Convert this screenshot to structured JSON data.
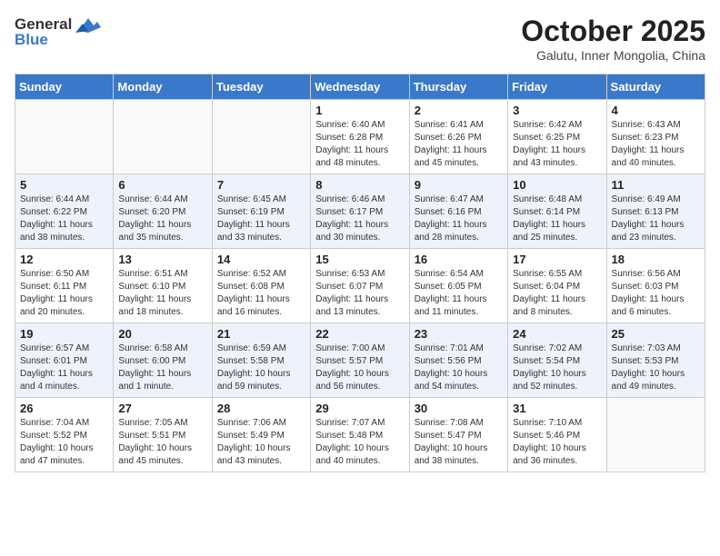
{
  "logo": {
    "general": "General",
    "blue": "Blue"
  },
  "title": "October 2025",
  "subtitle": "Galutu, Inner Mongolia, China",
  "days_of_week": [
    "Sunday",
    "Monday",
    "Tuesday",
    "Wednesday",
    "Thursday",
    "Friday",
    "Saturday"
  ],
  "weeks": [
    [
      {
        "day": "",
        "info": ""
      },
      {
        "day": "",
        "info": ""
      },
      {
        "day": "",
        "info": ""
      },
      {
        "day": "1",
        "info": "Sunrise: 6:40 AM\nSunset: 6:28 PM\nDaylight: 11 hours\nand 48 minutes."
      },
      {
        "day": "2",
        "info": "Sunrise: 6:41 AM\nSunset: 6:26 PM\nDaylight: 11 hours\nand 45 minutes."
      },
      {
        "day": "3",
        "info": "Sunrise: 6:42 AM\nSunset: 6:25 PM\nDaylight: 11 hours\nand 43 minutes."
      },
      {
        "day": "4",
        "info": "Sunrise: 6:43 AM\nSunset: 6:23 PM\nDaylight: 11 hours\nand 40 minutes."
      }
    ],
    [
      {
        "day": "5",
        "info": "Sunrise: 6:44 AM\nSunset: 6:22 PM\nDaylight: 11 hours\nand 38 minutes."
      },
      {
        "day": "6",
        "info": "Sunrise: 6:44 AM\nSunset: 6:20 PM\nDaylight: 11 hours\nand 35 minutes."
      },
      {
        "day": "7",
        "info": "Sunrise: 6:45 AM\nSunset: 6:19 PM\nDaylight: 11 hours\nand 33 minutes."
      },
      {
        "day": "8",
        "info": "Sunrise: 6:46 AM\nSunset: 6:17 PM\nDaylight: 11 hours\nand 30 minutes."
      },
      {
        "day": "9",
        "info": "Sunrise: 6:47 AM\nSunset: 6:16 PM\nDaylight: 11 hours\nand 28 minutes."
      },
      {
        "day": "10",
        "info": "Sunrise: 6:48 AM\nSunset: 6:14 PM\nDaylight: 11 hours\nand 25 minutes."
      },
      {
        "day": "11",
        "info": "Sunrise: 6:49 AM\nSunset: 6:13 PM\nDaylight: 11 hours\nand 23 minutes."
      }
    ],
    [
      {
        "day": "12",
        "info": "Sunrise: 6:50 AM\nSunset: 6:11 PM\nDaylight: 11 hours\nand 20 minutes."
      },
      {
        "day": "13",
        "info": "Sunrise: 6:51 AM\nSunset: 6:10 PM\nDaylight: 11 hours\nand 18 minutes."
      },
      {
        "day": "14",
        "info": "Sunrise: 6:52 AM\nSunset: 6:08 PM\nDaylight: 11 hours\nand 16 minutes."
      },
      {
        "day": "15",
        "info": "Sunrise: 6:53 AM\nSunset: 6:07 PM\nDaylight: 11 hours\nand 13 minutes."
      },
      {
        "day": "16",
        "info": "Sunrise: 6:54 AM\nSunset: 6:05 PM\nDaylight: 11 hours\nand 11 minutes."
      },
      {
        "day": "17",
        "info": "Sunrise: 6:55 AM\nSunset: 6:04 PM\nDaylight: 11 hours\nand 8 minutes."
      },
      {
        "day": "18",
        "info": "Sunrise: 6:56 AM\nSunset: 6:03 PM\nDaylight: 11 hours\nand 6 minutes."
      }
    ],
    [
      {
        "day": "19",
        "info": "Sunrise: 6:57 AM\nSunset: 6:01 PM\nDaylight: 11 hours\nand 4 minutes."
      },
      {
        "day": "20",
        "info": "Sunrise: 6:58 AM\nSunset: 6:00 PM\nDaylight: 11 hours\nand 1 minute."
      },
      {
        "day": "21",
        "info": "Sunrise: 6:59 AM\nSunset: 5:58 PM\nDaylight: 10 hours\nand 59 minutes."
      },
      {
        "day": "22",
        "info": "Sunrise: 7:00 AM\nSunset: 5:57 PM\nDaylight: 10 hours\nand 56 minutes."
      },
      {
        "day": "23",
        "info": "Sunrise: 7:01 AM\nSunset: 5:56 PM\nDaylight: 10 hours\nand 54 minutes."
      },
      {
        "day": "24",
        "info": "Sunrise: 7:02 AM\nSunset: 5:54 PM\nDaylight: 10 hours\nand 52 minutes."
      },
      {
        "day": "25",
        "info": "Sunrise: 7:03 AM\nSunset: 5:53 PM\nDaylight: 10 hours\nand 49 minutes."
      }
    ],
    [
      {
        "day": "26",
        "info": "Sunrise: 7:04 AM\nSunset: 5:52 PM\nDaylight: 10 hours\nand 47 minutes."
      },
      {
        "day": "27",
        "info": "Sunrise: 7:05 AM\nSunset: 5:51 PM\nDaylight: 10 hours\nand 45 minutes."
      },
      {
        "day": "28",
        "info": "Sunrise: 7:06 AM\nSunset: 5:49 PM\nDaylight: 10 hours\nand 43 minutes."
      },
      {
        "day": "29",
        "info": "Sunrise: 7:07 AM\nSunset: 5:48 PM\nDaylight: 10 hours\nand 40 minutes."
      },
      {
        "day": "30",
        "info": "Sunrise: 7:08 AM\nSunset: 5:47 PM\nDaylight: 10 hours\nand 38 minutes."
      },
      {
        "day": "31",
        "info": "Sunrise: 7:10 AM\nSunset: 5:46 PM\nDaylight: 10 hours\nand 36 minutes."
      },
      {
        "day": "",
        "info": ""
      }
    ]
  ]
}
